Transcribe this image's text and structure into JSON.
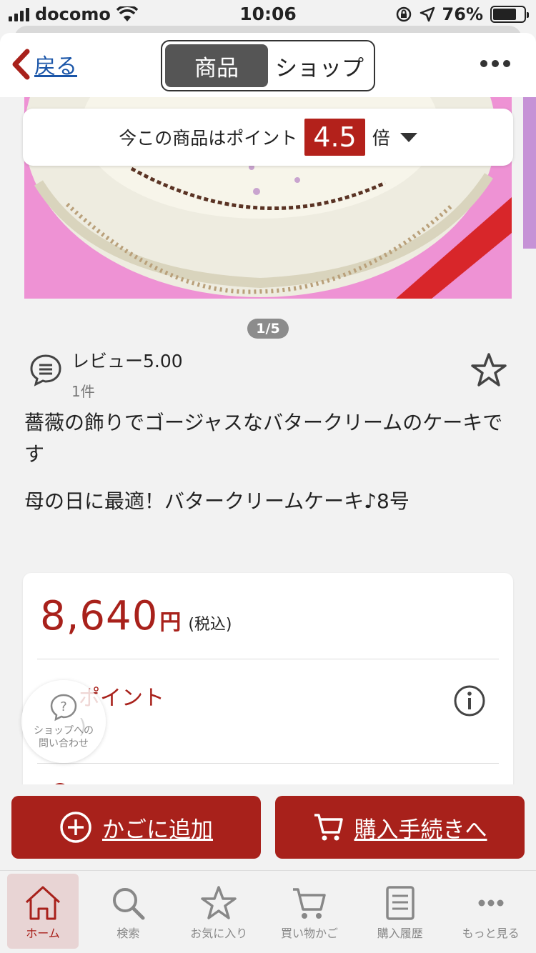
{
  "status_bar": {
    "carrier": "docomo",
    "time": "10:06",
    "battery": "76%",
    "battery_level": 0.76
  },
  "header": {
    "back_label": "戻る",
    "segments": [
      "商品",
      "ショップ"
    ],
    "active_segment": 0
  },
  "points_banner": {
    "prefix": "今この商品はポイント",
    "multiplier": "4.5",
    "suffix": "倍"
  },
  "gallery": {
    "pager": "1/5"
  },
  "review": {
    "label": "レビュー5.00",
    "count": "1件"
  },
  "product": {
    "description": "薔薇の飾りでゴージャスなバタークリームのケーキです",
    "title": "母の日に最適！バタークリームケーキ♪8号"
  },
  "price": {
    "amount": "8,640",
    "unit": "円",
    "tax": "(税込)"
  },
  "points_detail": {
    "label": "ポイント",
    "sub": ")"
  },
  "inquiry": {
    "label": "ショップへの\n問い合わせ"
  },
  "actions": {
    "add_to_cart": "かごに追加",
    "checkout": "購入手続きへ"
  },
  "tabs": [
    {
      "label": "ホーム",
      "icon": "home-icon"
    },
    {
      "label": "検索",
      "icon": "search-icon"
    },
    {
      "label": "お気に入り",
      "icon": "star-icon"
    },
    {
      "label": "買い物かご",
      "icon": "cart-icon"
    },
    {
      "label": "購入履歴",
      "icon": "history-icon"
    },
    {
      "label": "もっと見る",
      "icon": "more-icon"
    }
  ],
  "colors": {
    "accent": "#a8211b",
    "link": "#1a55a8",
    "image_bg": "#ee92d4"
  }
}
